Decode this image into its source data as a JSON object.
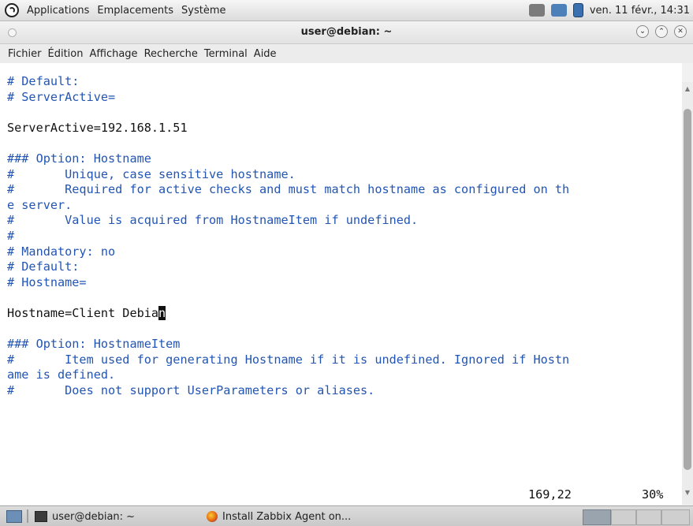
{
  "topbar": {
    "menus": [
      "Applications",
      "Emplacements",
      "Système"
    ],
    "clock": "ven. 11 févr., 14:31",
    "tray_icons": [
      "volume-icon",
      "network-icon",
      "battery-icon"
    ]
  },
  "window": {
    "title": "user@debian: ~",
    "buttons": [
      "minimize",
      "maximize",
      "close"
    ]
  },
  "menubar": [
    "Fichier",
    "Édition",
    "Affichage",
    "Recherche",
    "Terminal",
    "Aide"
  ],
  "terminal": {
    "lines": [
      {
        "text": "# Default:",
        "kind": "comment"
      },
      {
        "text": "# ServerActive=",
        "kind": "comment"
      },
      {
        "text": "",
        "kind": "plain"
      },
      {
        "text": "ServerActive=192.168.1.51",
        "kind": "plain"
      },
      {
        "text": "",
        "kind": "plain"
      },
      {
        "text": "### Option: Hostname",
        "kind": "comment"
      },
      {
        "text": "#       Unique, case sensitive hostname.",
        "kind": "comment"
      },
      {
        "text": "#       Required for active checks and must match hostname as configured on th",
        "kind": "comment"
      },
      {
        "text": "e server.",
        "kind": "comment"
      },
      {
        "text": "#       Value is acquired from HostnameItem if undefined.",
        "kind": "comment"
      },
      {
        "text": "#",
        "kind": "comment"
      },
      {
        "text": "# Mandatory: no",
        "kind": "comment"
      },
      {
        "text": "# Default:",
        "kind": "comment"
      },
      {
        "text": "# Hostname=",
        "kind": "comment"
      },
      {
        "text": "",
        "kind": "plain"
      },
      {
        "text": "Hostname=Client Debia",
        "kind": "plain",
        "cursor_char": "n"
      },
      {
        "text": "",
        "kind": "plain"
      },
      {
        "text": "### Option: HostnameItem",
        "kind": "comment"
      },
      {
        "text": "#       Item used for generating Hostname if it is undefined. Ignored if Hostn",
        "kind": "comment"
      },
      {
        "text": "ame is defined.",
        "kind": "comment"
      },
      {
        "text": "#       Does not support UserParameters or aliases.",
        "kind": "comment"
      }
    ],
    "status_position": "169,22",
    "status_percent": "30%"
  },
  "taskbar": {
    "tasks": [
      {
        "label": "user@debian: ~",
        "icon": "terminal-icon"
      },
      {
        "label": "Install Zabbix Agent on...",
        "icon": "firefox-icon"
      }
    ]
  },
  "colors": {
    "comment": "#2255b4",
    "text": "#1e1e1e",
    "background": "#ffffff"
  }
}
